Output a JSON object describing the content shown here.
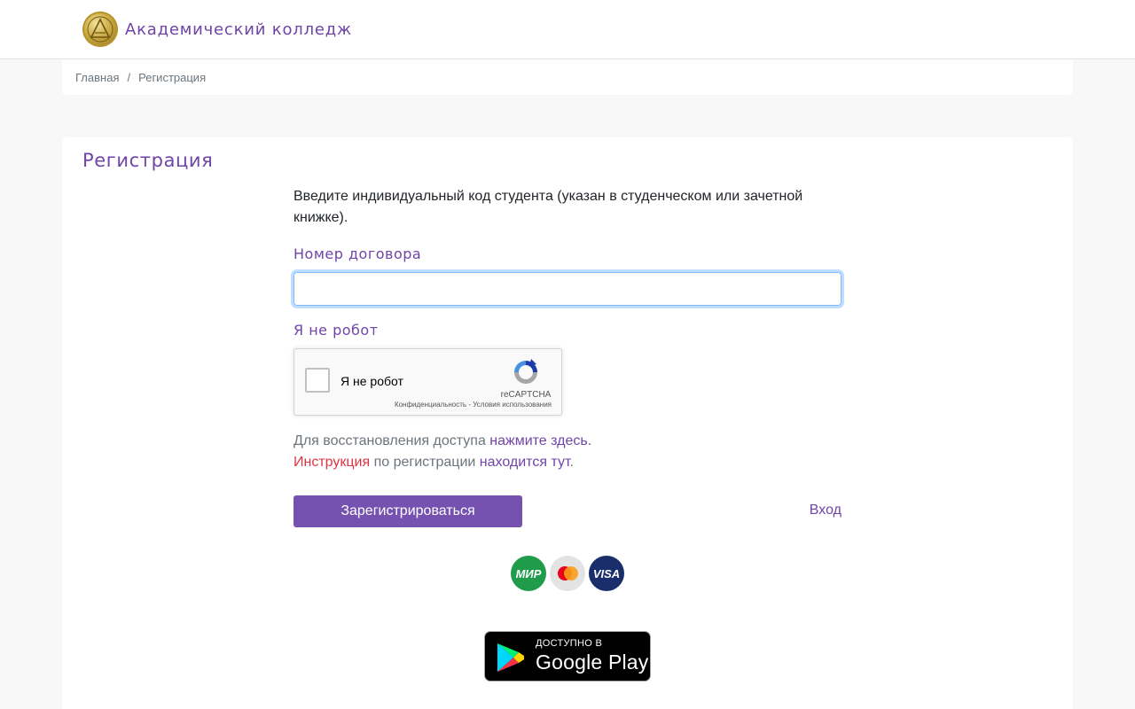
{
  "header": {
    "brand_name": "Академический колледж",
    "logo_icon": "college-seal-logo"
  },
  "breadcrumb": {
    "items": [
      "Главная",
      "Регистрация"
    ],
    "separator": "/"
  },
  "card": {
    "title": "Регистрация"
  },
  "form": {
    "intro": "Введите индивидуальный код студента (указан в студенческом или зачетной книжке).",
    "contract_label": "Номер договора",
    "contract_value": "",
    "robot_label": "Я не робот",
    "captcha": {
      "checkbox_text": "Я не робот",
      "brand": "reCAPTCHA",
      "privacy": "Конфиденциальность",
      "link_sep": " - ",
      "terms": "Условия использования"
    },
    "recovery": {
      "text": "Для восстановления доступа ",
      "link": "нажмите здесь."
    },
    "instruction": {
      "link_red": "Инструкция",
      "middle": " по регистрации ",
      "link": "находится тут",
      "tail": "."
    },
    "submit_label": "Зарегистрироваться",
    "login_label": "Вход"
  },
  "payments": {
    "mir": "МИР",
    "visa": "VISA",
    "mastercard_icon": "mastercard-logo"
  },
  "google_play": {
    "small": "ДОСТУПНО В",
    "big": "Google Play"
  },
  "colors": {
    "accent": "#7044a8",
    "button": "#7652b0",
    "danger": "#dc3545",
    "muted": "#6c757d"
  }
}
